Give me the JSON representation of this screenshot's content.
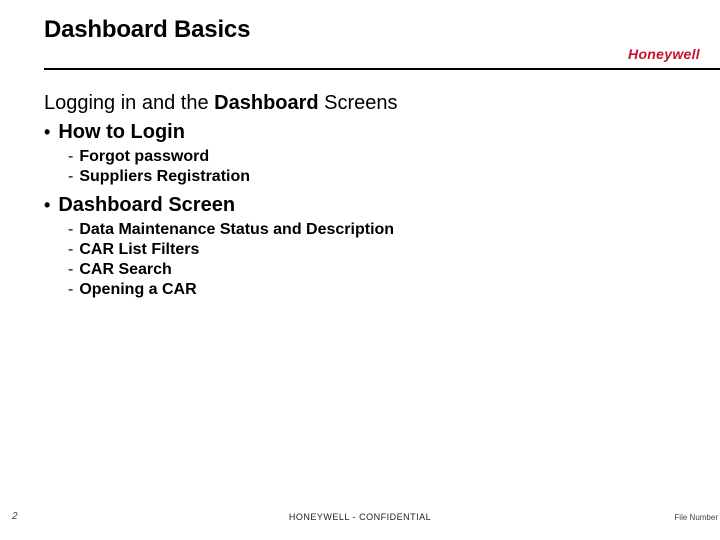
{
  "title": "Dashboard Basics",
  "brand": "Honeywell",
  "subhead": {
    "part1": "Logging in and the ",
    "bold": "Dashboard",
    "part3": " Screens"
  },
  "bullets": [
    {
      "label": "How to Login",
      "subs": [
        "Forgot password",
        "Suppliers Registration"
      ]
    },
    {
      "label": "Dashboard Screen",
      "subs": [
        "Data Maintenance Status and Description",
        "CAR List Filters",
        "CAR Search",
        "Opening a CAR"
      ]
    }
  ],
  "footer": {
    "page": "2",
    "center": "HONEYWELL - CONFIDENTIAL",
    "right": "File Number"
  }
}
